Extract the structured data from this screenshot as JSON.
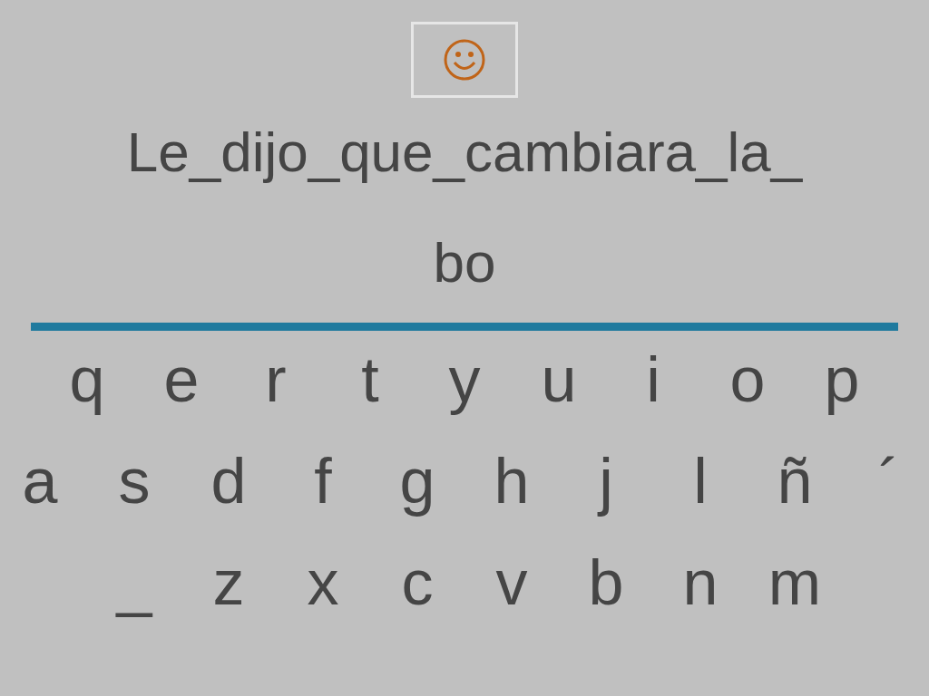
{
  "prompt": "Le_dijo_que_cambiara_la_",
  "answer": "bo",
  "keyboard": [
    [
      "q",
      "e",
      "r",
      "t",
      "y",
      "u",
      "i",
      "o",
      "p"
    ],
    [
      "a",
      "s",
      "d",
      "f",
      "g",
      "h",
      "j",
      "l",
      "ñ",
      "´"
    ],
    [
      "_",
      "z",
      "x",
      "c",
      "v",
      "b",
      "n",
      "m"
    ]
  ]
}
